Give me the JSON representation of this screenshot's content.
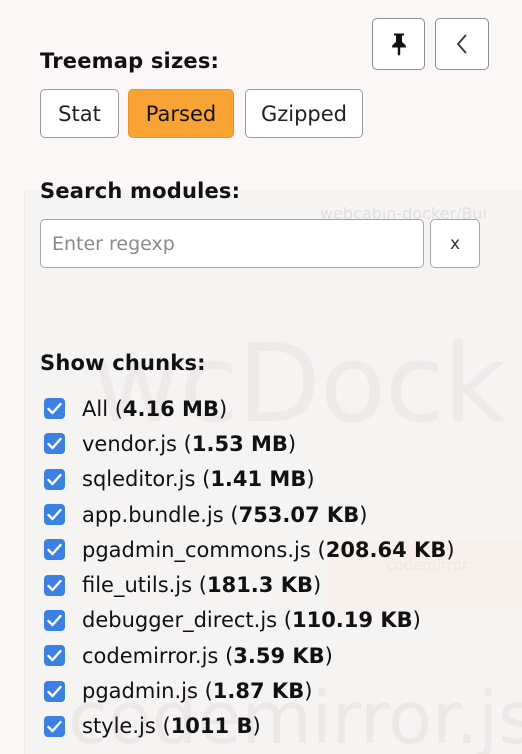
{
  "background": {
    "path_text": "webcabin-docker/Bui",
    "big_label": "wcDock",
    "inner_label": "codemirror",
    "bottom_label": "codemirror.js"
  },
  "toolbar": {
    "pin_icon": "pin-icon",
    "collapse_icon": "chevron-left-icon"
  },
  "treemap_sizes": {
    "title": "Treemap sizes:",
    "options": [
      "Stat",
      "Parsed",
      "Gzipped"
    ],
    "selected": "Parsed",
    "active_color": "#f9a334"
  },
  "search": {
    "title": "Search modules:",
    "placeholder": "Enter regexp",
    "value": "",
    "clear_label": "x"
  },
  "chunks": {
    "title": "Show chunks:",
    "checkbox_color": "#3b80e3",
    "items": [
      {
        "name": "All",
        "size": "4.16 MB",
        "checked": true
      },
      {
        "name": "vendor.js",
        "size": "1.53 MB",
        "checked": true
      },
      {
        "name": "sqleditor.js",
        "size": "1.41 MB",
        "checked": true
      },
      {
        "name": "app.bundle.js",
        "size": "753.07 KB",
        "checked": true
      },
      {
        "name": "pgadmin_commons.js",
        "size": "208.64 KB",
        "checked": true
      },
      {
        "name": "file_utils.js",
        "size": "181.3 KB",
        "checked": true
      },
      {
        "name": "debugger_direct.js",
        "size": "110.19 KB",
        "checked": true
      },
      {
        "name": "codemirror.js",
        "size": "3.59 KB",
        "checked": true
      },
      {
        "name": "pgadmin.js",
        "size": "1.87 KB",
        "checked": true
      },
      {
        "name": "style.js",
        "size": "1011 B",
        "checked": true
      }
    ]
  }
}
